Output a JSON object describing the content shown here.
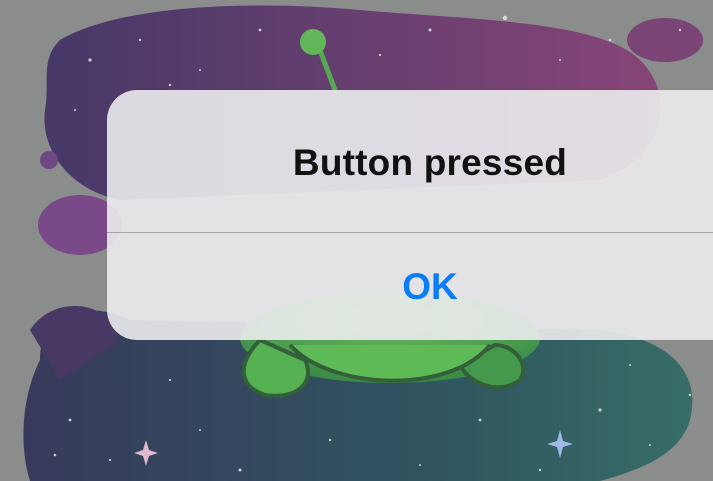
{
  "alert": {
    "title": "Button pressed",
    "button_label": "OK"
  },
  "colors": {
    "accent": "#0a7df7",
    "title": "#111111",
    "alert_background": "#ececee"
  },
  "icons": {
    "wallpaper": "space-alien-illustration"
  }
}
